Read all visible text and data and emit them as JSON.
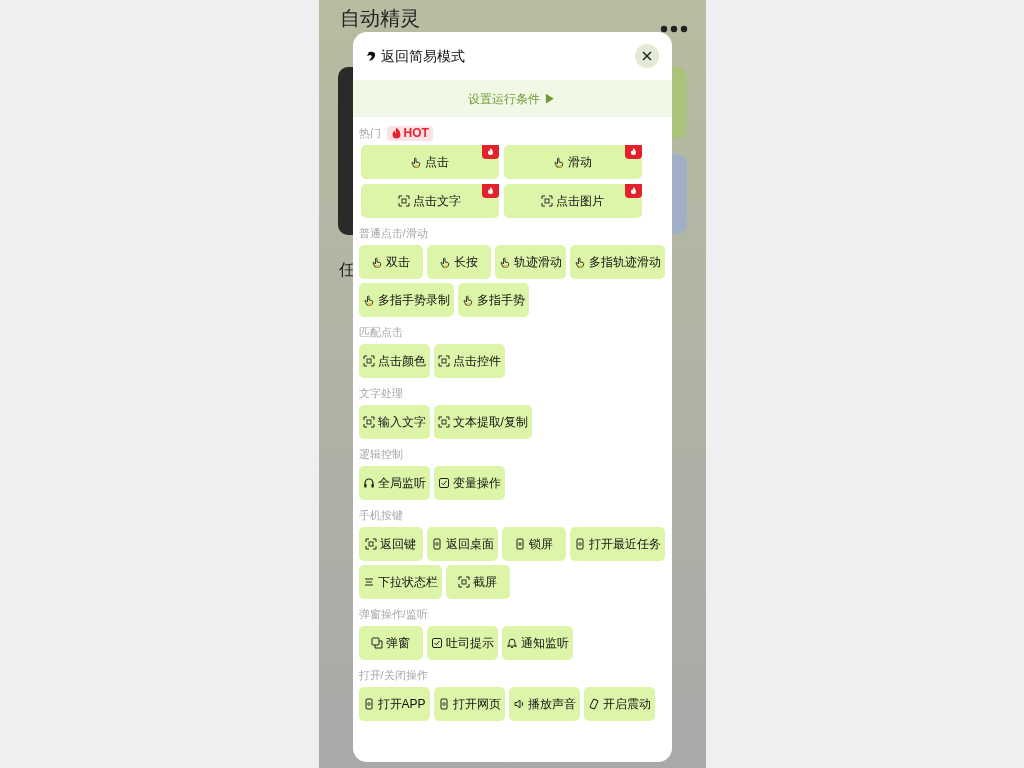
{
  "app_title": "自动精灵",
  "background_label": "任",
  "dialog": {
    "back_label": "返回简易模式",
    "condition_button": "设置运行条件 ▶",
    "groups": [
      {
        "title": "热门",
        "badge": "HOT",
        "kind": "grid",
        "items": [
          {
            "label": "点击",
            "hot": true
          },
          {
            "label": "滑动",
            "hot": true
          },
          {
            "label": "点击文字",
            "hot": true
          },
          {
            "label": "点击图片",
            "hot": true
          }
        ]
      },
      {
        "title": "普通点击/滑动",
        "kind": "flow",
        "items": [
          {
            "label": "双击"
          },
          {
            "label": "长按"
          },
          {
            "label": "轨迹滑动"
          },
          {
            "label": "多指轨迹滑动"
          },
          {
            "label": "多指手势录制"
          },
          {
            "label": "多指手势"
          }
        ]
      },
      {
        "title": "匹配点击",
        "kind": "flow",
        "items": [
          {
            "label": "点击颜色"
          },
          {
            "label": "点击控件"
          }
        ]
      },
      {
        "title": "文字处理",
        "kind": "flow",
        "items": [
          {
            "label": "输入文字"
          },
          {
            "label": "文本提取/复制"
          }
        ]
      },
      {
        "title": "逻辑控制",
        "kind": "flow",
        "items": [
          {
            "label": "全局监听"
          },
          {
            "label": "变量操作"
          }
        ]
      },
      {
        "title": "手机按键",
        "kind": "flow",
        "items": [
          {
            "label": "返回键"
          },
          {
            "label": "返回桌面"
          },
          {
            "label": "锁屏"
          },
          {
            "label": "打开最近任务"
          },
          {
            "label": "下拉状态栏"
          },
          {
            "label": "截屏"
          }
        ]
      },
      {
        "title": "弹窗操作/监听",
        "kind": "flow",
        "items": [
          {
            "label": "弹窗"
          },
          {
            "label": "吐司提示"
          },
          {
            "label": "通知监听"
          }
        ]
      },
      {
        "title": "打开/关闭操作",
        "kind": "flow",
        "items": [
          {
            "label": "打开APP"
          },
          {
            "label": "打开网页"
          },
          {
            "label": "播放声音"
          },
          {
            "label": "开启震动"
          }
        ]
      }
    ]
  }
}
